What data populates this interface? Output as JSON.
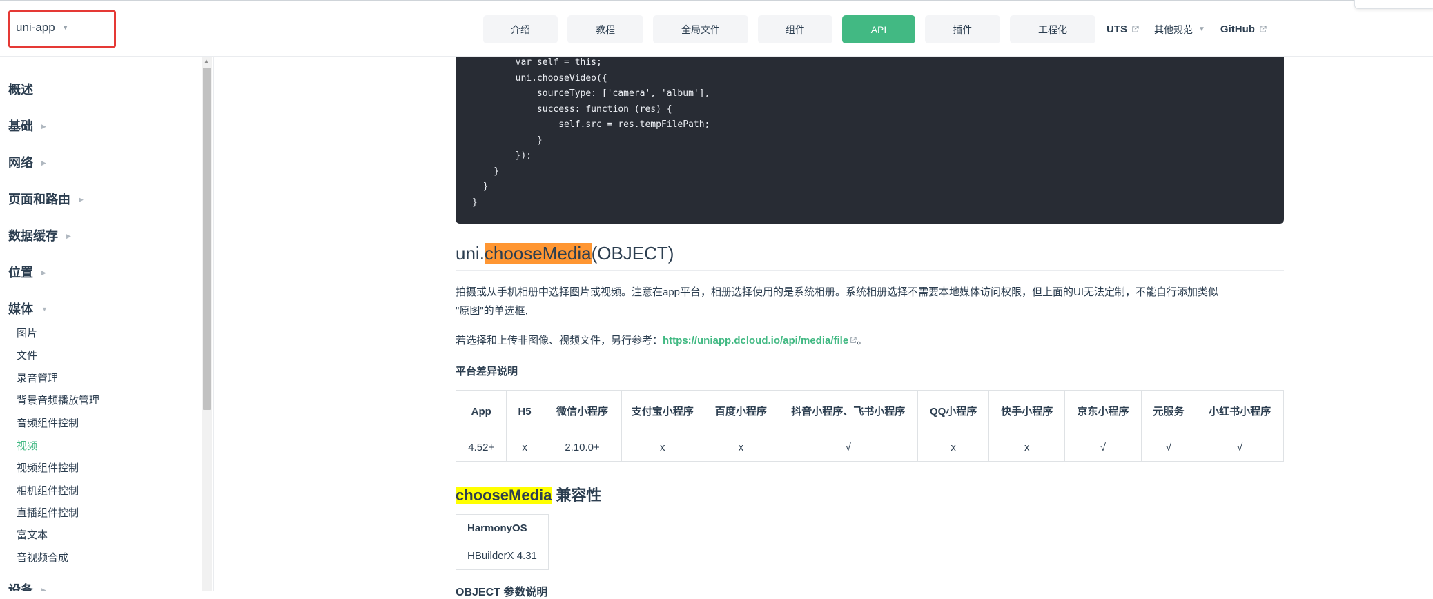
{
  "header": {
    "brand": "uni-app",
    "nav": [
      {
        "label": "介绍"
      },
      {
        "label": "教程"
      },
      {
        "label": "全局文件"
      },
      {
        "label": "组件"
      },
      {
        "label": "API",
        "active": true
      },
      {
        "label": "插件"
      },
      {
        "label": "工程化"
      }
    ],
    "links": {
      "uts": "UTS",
      "other_specs": "其他规范",
      "github": "GitHub"
    }
  },
  "sidebar": {
    "sections": [
      {
        "label": "概述"
      },
      {
        "label": "基础"
      },
      {
        "label": "网络"
      },
      {
        "label": "页面和路由"
      },
      {
        "label": "数据缓存"
      },
      {
        "label": "位置"
      },
      {
        "label": "媒体"
      },
      {
        "label": "设备"
      }
    ],
    "media_items": [
      {
        "label": "图片"
      },
      {
        "label": "文件"
      },
      {
        "label": "录音管理"
      },
      {
        "label": "背景音频播放管理"
      },
      {
        "label": "音频组件控制"
      },
      {
        "label": "视频",
        "active": true
      },
      {
        "label": "视频组件控制"
      },
      {
        "label": "相机组件控制"
      },
      {
        "label": "直播组件控制"
      },
      {
        "label": "富文本"
      },
      {
        "label": "音视频合成"
      }
    ]
  },
  "code": {
    "lines": [
      "        var self = this;",
      "        uni.chooseVideo({",
      "            sourceType: ['camera', 'album'],",
      "            success: function (res) {",
      "                self.src = res.tempFilePath;",
      "            }",
      "        });",
      "    }",
      "  }",
      "}"
    ]
  },
  "article": {
    "title_prefix": "uni.",
    "title_highlight": "chooseMedia",
    "title_suffix": "(OBJECT)",
    "desc_line1": "拍摄或从手机相册中选择图片或视频。注意在app平台，相册选择使用的是系统相册。系统相册选择不需要本地媒体访问权限，但上面的UI无法定制，不能自行添加类似",
    "desc_line2": "\"原图\"的单选框,",
    "ref_prefix": "若选择和上传非图像、视频文件，另行参考：",
    "ref_link": "https://uniapp.dcloud.io/api/media/file",
    "ref_suffix": "。",
    "platform_heading": "平台差异说明",
    "platform_table": {
      "headers": [
        "App",
        "H5",
        "微信小程序",
        "支付宝小程序",
        "百度小程序",
        "抖音小程序、飞书小程序",
        "QQ小程序",
        "快手小程序",
        "京东小程序",
        "元服务",
        "小红书小程序"
      ],
      "row": [
        "4.52+",
        "x",
        "2.10.0+",
        "x",
        "x",
        "√",
        "x",
        "x",
        "√",
        "√",
        "√"
      ]
    },
    "compat_highlight": "chooseMedia",
    "compat_suffix": " 兼容性",
    "compat_table": {
      "header": "HarmonyOS",
      "value": "HBuilderX 4.31"
    },
    "next_heading": "OBJECT 参数说明"
  },
  "colors": {
    "accent": "#42b983",
    "search_highlight_current": "#ff9632",
    "search_highlight": "#ffff00",
    "code_background": "#282c34"
  }
}
